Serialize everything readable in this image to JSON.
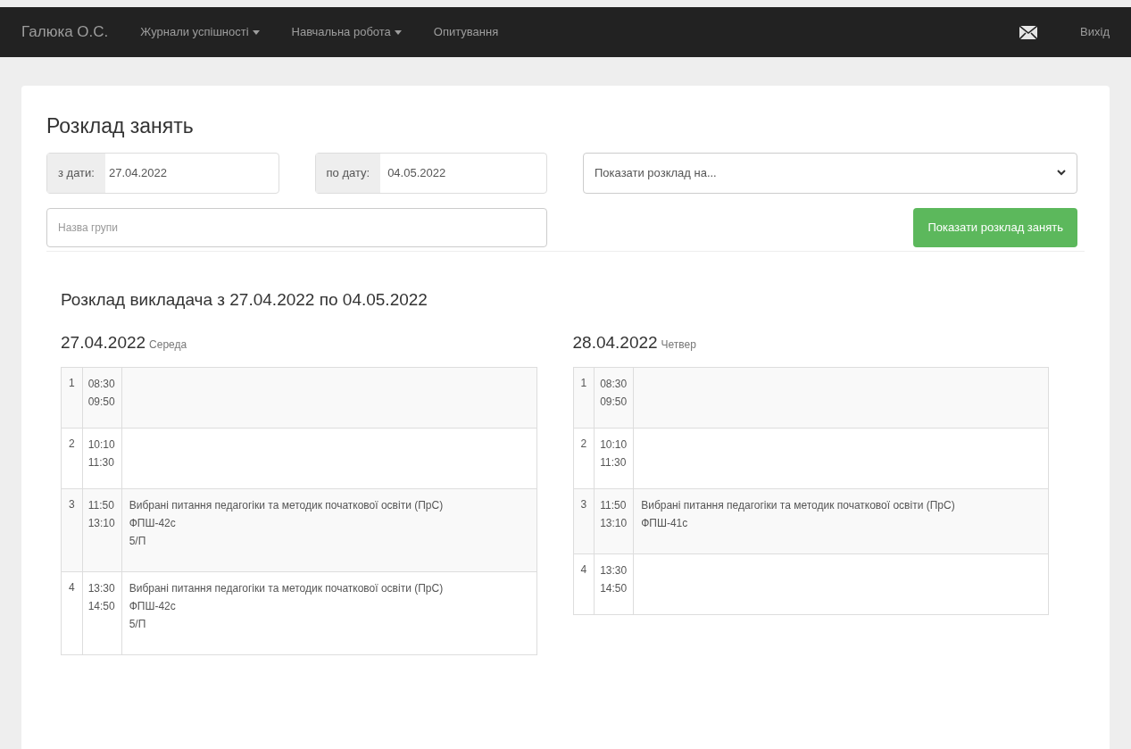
{
  "navbar": {
    "brand": "Галюка О.С.",
    "items": [
      {
        "label": "Журнали успішності",
        "kind": "dropdown"
      },
      {
        "label": "Навчальна робота",
        "kind": "dropdown"
      },
      {
        "label": "Опитування",
        "kind": "link"
      }
    ],
    "logout": "Вихід"
  },
  "page_title": "Розклад занять",
  "filters": {
    "from_label": "з дати:",
    "from_value": "27.04.2022",
    "to_label": "по дату:",
    "to_value": "04.05.2022",
    "select_placeholder": "Показати розклад на...",
    "group_placeholder": "Назва групи",
    "submit": "Показати розклад занять"
  },
  "schedule_title": "Розклад викладача з 27.04.2022 по 04.05.2022",
  "days": [
    {
      "date": "27.04.2022",
      "weekday": "Середа",
      "lessons": [
        {
          "number": "1",
          "start": "08:30",
          "end": "09:50"
        },
        {
          "number": "2",
          "start": "10:10",
          "end": "11:30"
        },
        {
          "number": "3",
          "start": "11:50",
          "end": "13:10",
          "lines": [
            "Вибрані питання педагогіки та методик початкової освіти (ПрС)",
            "ФПШ-42с",
            "5/П"
          ]
        },
        {
          "number": "4",
          "start": "13:30",
          "end": "14:50",
          "lines": [
            "Вибрані питання педагогіки та методик початкової освіти (ПрС)",
            "ФПШ-42с",
            "5/П"
          ]
        }
      ]
    },
    {
      "date": "28.04.2022",
      "weekday": "Четвер",
      "lessons": [
        {
          "number": "1",
          "start": "08:30",
          "end": "09:50"
        },
        {
          "number": "2",
          "start": "10:10",
          "end": "11:30"
        },
        {
          "number": "3",
          "start": "11:50",
          "end": "13:10",
          "lines": [
            "Вибрані питання педагогіки та методик початкової освіти (ПрС)",
            "ФПШ-41с"
          ]
        },
        {
          "number": "4",
          "start": "13:30",
          "end": "14:50"
        }
      ]
    }
  ]
}
